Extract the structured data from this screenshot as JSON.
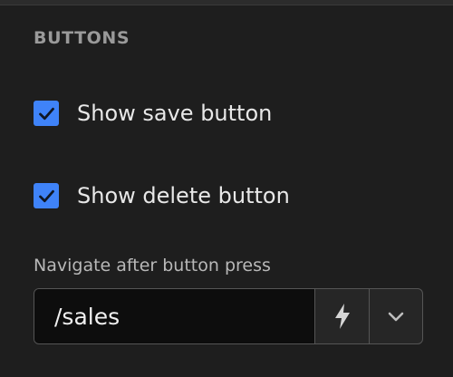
{
  "section": {
    "title": "BUTTONS"
  },
  "options": {
    "show_save_button": {
      "label": "Show save button",
      "checked": true
    },
    "show_delete_button": {
      "label": "Show delete button",
      "checked": true
    }
  },
  "navigate_after_press": {
    "label": "Navigate after button press",
    "value": "/sales"
  },
  "icons": {
    "dynamic_value": "lightning-bolt-icon",
    "dropdown": "chevron-down-icon"
  },
  "colors": {
    "checkbox_accent": "#3f83f8",
    "background": "#1e1e1e",
    "input_background": "#0d0d0d"
  }
}
